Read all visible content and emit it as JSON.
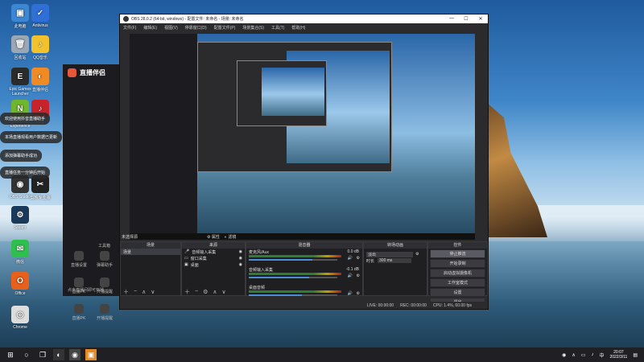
{
  "desktop": {
    "icons": [
      {
        "label": "此电脑",
        "glyph": "▣",
        "color": "#3b87d6"
      },
      {
        "label": "Antivirus",
        "glyph": "✓",
        "color": "#2f6fd6"
      },
      {
        "label": "回收站",
        "glyph": "🗑",
        "color": "#9aa7b5"
      },
      {
        "label": "QQ音乐",
        "glyph": "♪",
        "color": "#f2c12e"
      },
      {
        "label": "Epic Games Launcher",
        "glyph": "E",
        "color": "#2b2b2b"
      },
      {
        "label": "直播伴侣",
        "glyph": "◐",
        "color": "#f08a24"
      },
      {
        "label": "GeForce Experience",
        "glyph": "N",
        "color": "#6fb62c"
      },
      {
        "label": "抖音",
        "glyph": "♪",
        "color": "#c8232b"
      },
      {
        "label": "OBS Studio",
        "glyph": "◉",
        "color": "#333"
      },
      {
        "label": "剪映专业版",
        "glyph": "✂",
        "color": "#222"
      },
      {
        "label": "Steam",
        "glyph": "⚙",
        "color": "#1b3a5b"
      },
      {
        "label": "微信",
        "glyph": "✉",
        "color": "#2fbf4f"
      },
      {
        "label": "Office",
        "glyph": "O",
        "color": "#e8601c"
      },
      {
        "label": "Chrome",
        "glyph": "◎",
        "color": "#ddd"
      }
    ]
  },
  "live_app": {
    "title": "直播伴侣",
    "tab_label": "工具箱",
    "tiles": [
      "直播设置",
      "弹幕助手",
      "直播PK",
      "开播提醒",
      "直播PK",
      "开播提醒"
    ],
    "footer": "点击直播间即可开播",
    "notifications": [
      "欢迎使用抖音直播助手",
      "本场直播观看用户数据已更新",
      "添加弹幕助手成功",
      "直播任务一分钟后开始"
    ]
  },
  "obs": {
    "window_title": "OBS 28.0.2 (64-bit, windows) - 配置文件: 未命名 - 场景: 未命名",
    "menu": [
      "文件(F)",
      "编辑(E)",
      "视图(V)",
      "停靠窗口(D)",
      "配置文件(P)",
      "场景集合(S)",
      "工具(T)",
      "帮助(H)"
    ],
    "source_note": "未选择源",
    "source_props": "属性",
    "source_filters": "滤镜",
    "scenes_header": "场景",
    "scenes": [
      "场景"
    ],
    "sources_header": "来源",
    "sources": [
      "音频输入采集",
      "窗口采集",
      "桌面"
    ],
    "mixer_header": "混音器",
    "mixer_channels": [
      {
        "name": "麦克风/Aux",
        "db": "0.0 dB",
        "level": 0.72
      },
      {
        "name": "音频输入采集",
        "db": "-0.1 dB",
        "level": 0.68
      },
      {
        "name": "桌面音频",
        "db": "",
        "level": 0.6
      }
    ],
    "transitions_header": "转场动画",
    "transition_type": "淡出",
    "duration_label": "时长",
    "duration_value": "300 ms",
    "controls_header": "控件",
    "controls": [
      "停止推流",
      "开始录制",
      "启动虚拟摄像机",
      "工作室模式",
      "设置",
      "退出"
    ],
    "status": {
      "live": "LIVE: 00:00:00",
      "rec": "REC: 00:00:00",
      "cpu": "CPU: 1.4%, 60.00 fps"
    }
  },
  "taskbar": {
    "time": "20:07",
    "date": "2022/3/11"
  }
}
